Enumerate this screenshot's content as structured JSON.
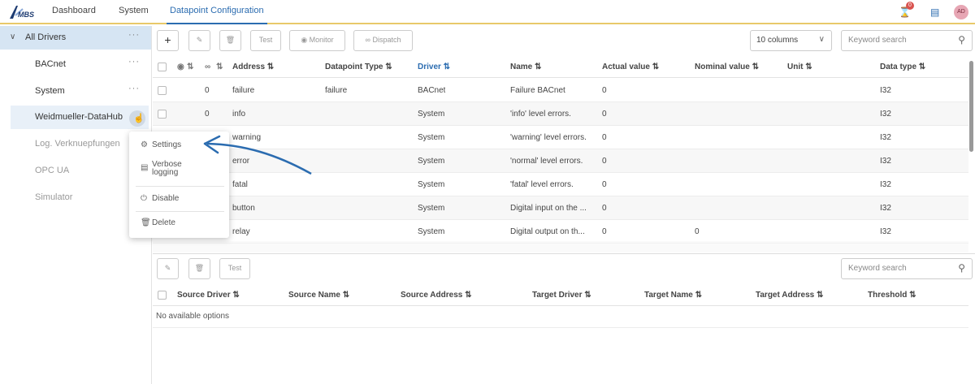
{
  "app": {
    "logo": "MBS",
    "nav": [
      "Dashboard",
      "System",
      "Datapoint Configuration"
    ],
    "notification_count": "0",
    "avatar": "AD"
  },
  "sidebar": {
    "items": [
      {
        "label": "All Drivers"
      },
      {
        "label": "BACnet"
      },
      {
        "label": "System"
      },
      {
        "label": "Weidmueller-DataHub"
      },
      {
        "label": "Log. Verknuepfungen"
      },
      {
        "label": "OPC UA"
      },
      {
        "label": "Simulator"
      }
    ],
    "more": "···"
  },
  "context_menu": {
    "items": [
      "Settings",
      "Verbose\nlogging",
      "Disable",
      "Delete"
    ]
  },
  "toolbar": {
    "add": "+",
    "test": "Test",
    "monitor": "Monitor",
    "dispatch": "Dispatch",
    "columns": "10 columns",
    "search_placeholder": "Keyword search"
  },
  "datapoints": {
    "columns": [
      "Address",
      "Datapoint Type",
      "Driver",
      "Name",
      "Actual value",
      "Nominal value",
      "Unit",
      "Data type"
    ],
    "rows": [
      {
        "id": "0",
        "address": "failure",
        "type": "failure",
        "driver": "BACnet",
        "name": "Failure BACnet",
        "actual": "0",
        "nominal": "",
        "unit": "",
        "dtype": "I32"
      },
      {
        "id": "0",
        "address": "info",
        "type": "",
        "driver": "System",
        "name": "'info' level errors.",
        "actual": "0",
        "nominal": "",
        "unit": "",
        "dtype": "I32"
      },
      {
        "id": "",
        "address": "warning",
        "type": "",
        "driver": "System",
        "name": "'warning' level errors.",
        "actual": "0",
        "nominal": "",
        "unit": "",
        "dtype": "I32"
      },
      {
        "id": "",
        "address": "error",
        "type": "",
        "driver": "System",
        "name": "'normal' level errors.",
        "actual": "0",
        "nominal": "",
        "unit": "",
        "dtype": "I32"
      },
      {
        "id": "",
        "address": "fatal",
        "type": "",
        "driver": "System",
        "name": "'fatal' level errors.",
        "actual": "0",
        "nominal": "",
        "unit": "",
        "dtype": "I32"
      },
      {
        "id": "",
        "address": "button",
        "type": "",
        "driver": "System",
        "name": "Digital input on the ...",
        "actual": "0",
        "nominal": "",
        "unit": "",
        "dtype": "I32"
      },
      {
        "id": "",
        "address": "relay",
        "type": "",
        "driver": "System",
        "name": "Digital output on th...",
        "actual": "0",
        "nominal": "0",
        "unit": "",
        "dtype": "I32"
      }
    ]
  },
  "links_toolbar": {
    "test": "Test",
    "search_placeholder": "Keyword search"
  },
  "links": {
    "columns": [
      "Source Driver",
      "Source Name",
      "Source Address",
      "Target Driver",
      "Target Name",
      "Target Address",
      "Threshold"
    ],
    "empty": "No available options"
  },
  "colors": {
    "accent": "#2b6cb0",
    "topbar_border": "#e8c96a",
    "selected": "#d6e5f3"
  }
}
